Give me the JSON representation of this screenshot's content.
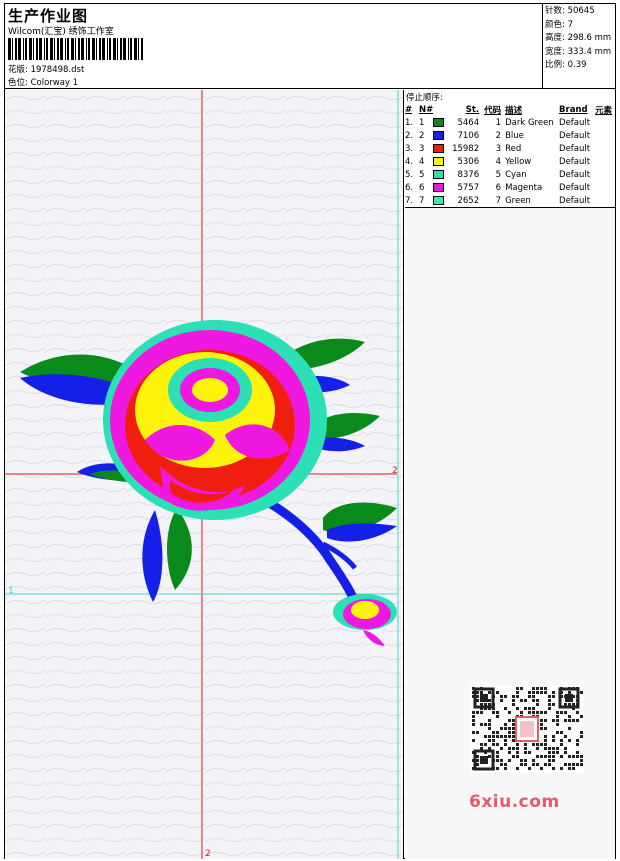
{
  "header": {
    "title": "生产作业图",
    "subtitle": "Wilcom(汇宝) 绣饰工作室",
    "design_label": "花版:",
    "design_value": "1978498.dst",
    "colorway_label": "色位:",
    "colorway_value": "Colorway 1"
  },
  "stats": [
    {
      "label": "针数:",
      "value": "50645"
    },
    {
      "label": "颜色:",
      "value": "7"
    },
    {
      "label": "高度:",
      "value": "298.6 mm"
    },
    {
      "label": "宽度:",
      "value": "333.4 mm"
    },
    {
      "label": "比例:",
      "value": "0.39"
    }
  ],
  "stop_sequence": {
    "label": "停止顺序:",
    "columns": [
      "#",
      "N#",
      "St.",
      "代码",
      "描述",
      "Brand",
      "元素"
    ],
    "rows": [
      {
        "num": "1.",
        "n": "1",
        "color": "#0b8a1c",
        "st": "5464",
        "code": "1",
        "desc": "Dark Green",
        "brand": "Default"
      },
      {
        "num": "2.",
        "n": "2",
        "color": "#1420e8",
        "st": "7106",
        "code": "2",
        "desc": "Blue",
        "brand": "Default"
      },
      {
        "num": "3.",
        "n": "3",
        "color": "#f01e0e",
        "st": "15982",
        "code": "3",
        "desc": "Red",
        "brand": "Default"
      },
      {
        "num": "4.",
        "n": "4",
        "color": "#fbf40a",
        "st": "5306",
        "code": "4",
        "desc": "Yellow",
        "brand": "Default"
      },
      {
        "num": "5.",
        "n": "5",
        "color": "#2be0b4",
        "st": "8376",
        "code": "5",
        "desc": "Cyan",
        "brand": "Default"
      },
      {
        "num": "6.",
        "n": "6",
        "color": "#ee18e0",
        "st": "5757",
        "code": "6",
        "desc": "Magenta",
        "brand": "Default"
      },
      {
        "num": "7.",
        "n": "7",
        "color": "#2ef0a8",
        "st": "2652",
        "code": "7",
        "desc": "Green",
        "brand": "Default"
      }
    ]
  },
  "markers": {
    "red_label": "2",
    "cyan_label": "1"
  },
  "watermark": {
    "text": "6xiu.com"
  },
  "colors": {
    "guide_red": "#e01818",
    "guide_cyan": "#3fd9c8",
    "background": "#f4f3f7"
  }
}
